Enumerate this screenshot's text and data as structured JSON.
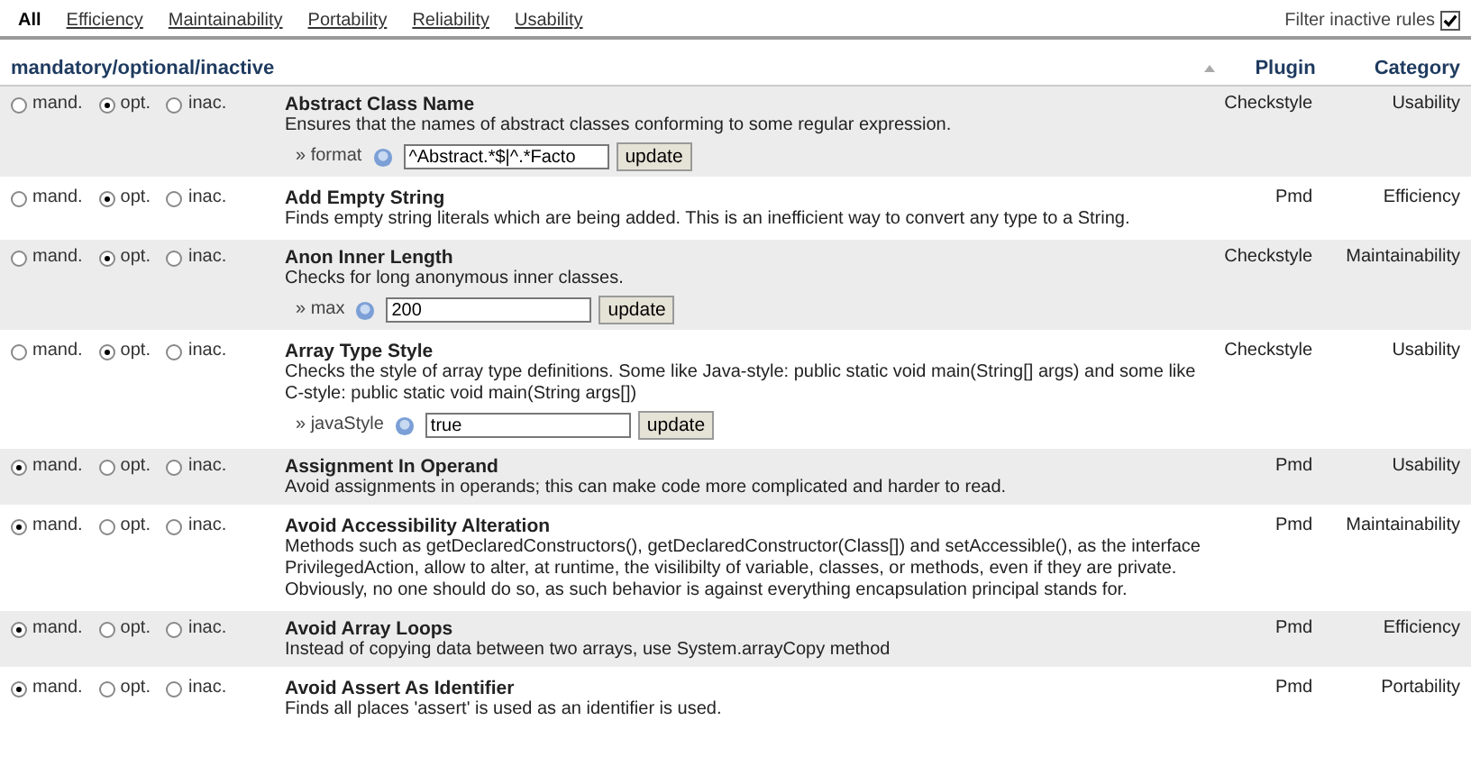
{
  "tabs": [
    {
      "label": "All",
      "selected": true
    },
    {
      "label": "Efficiency",
      "selected": false
    },
    {
      "label": "Maintainability",
      "selected": false
    },
    {
      "label": "Portability",
      "selected": false
    },
    {
      "label": "Reliability",
      "selected": false
    },
    {
      "label": "Usability",
      "selected": false
    }
  ],
  "filter": {
    "label": "Filter inactive rules",
    "checked": true
  },
  "table": {
    "columns": [
      "mandatory/optional/inactive",
      "Plugin",
      "Category"
    ],
    "rows": [
      {
        "options": [
          {
            "label": "mand.",
            "selected": false
          },
          {
            "label": "opt.",
            "selected": true
          },
          {
            "label": "inac.",
            "selected": false
          }
        ],
        "name": "Abstract Class Name",
        "description": "Ensures that the names of abstract classes conforming to some regular expression.",
        "param": {
          "name": "» format",
          "value": "^Abstract.*$|^.*Facto",
          "button": "update"
        },
        "plugin": "Checkstyle",
        "category": "Usability"
      },
      {
        "options": [
          {
            "label": "mand.",
            "selected": false
          },
          {
            "label": "opt.",
            "selected": true
          },
          {
            "label": "inac.",
            "selected": false
          }
        ],
        "name": "Add Empty String",
        "description": "Finds empty string literals which are being added. This is an inefficient way to convert any type to a String.",
        "plugin": "Pmd",
        "category": "Efficiency"
      },
      {
        "options": [
          {
            "label": "mand.",
            "selected": false
          },
          {
            "label": "opt.",
            "selected": true
          },
          {
            "label": "inac.",
            "selected": false
          }
        ],
        "name": "Anon Inner Length",
        "description": "Checks for long anonymous inner classes.",
        "param": {
          "name": "» max",
          "value": "200",
          "button": "update"
        },
        "plugin": "Checkstyle",
        "category": "Maintainability"
      },
      {
        "options": [
          {
            "label": "mand.",
            "selected": false
          },
          {
            "label": "opt.",
            "selected": true
          },
          {
            "label": "inac.",
            "selected": false
          }
        ],
        "name": "Array Type Style",
        "description": "Checks the style of array type definitions. Some like Java-style: public static void main(String[] args) and some like C-style: public static void main(String args[])",
        "param": {
          "name": "» javaStyle",
          "value": "true",
          "button": "update"
        },
        "plugin": "Checkstyle",
        "category": "Usability"
      },
      {
        "options": [
          {
            "label": "mand.",
            "selected": true
          },
          {
            "label": "opt.",
            "selected": false
          },
          {
            "label": "inac.",
            "selected": false
          }
        ],
        "name": "Assignment In Operand",
        "description": "Avoid assignments in operands; this can make code more complicated and harder to read.",
        "plugin": "Pmd",
        "category": "Usability"
      },
      {
        "options": [
          {
            "label": "mand.",
            "selected": true
          },
          {
            "label": "opt.",
            "selected": false
          },
          {
            "label": "inac.",
            "selected": false
          }
        ],
        "name": "Avoid Accessibility Alteration",
        "description": "Methods such as getDeclaredConstructors(), getDeclaredConstructor(Class[]) and setAccessible(), as the interface PrivilegedAction, allow to alter, at runtime, the visilibilty of variable, classes, or methods, even if they are private. Obviously, no one should do so, as such behavior is against everything encapsulation principal stands for.",
        "plugin": "Pmd",
        "category": "Maintainability"
      },
      {
        "options": [
          {
            "label": "mand.",
            "selected": true
          },
          {
            "label": "opt.",
            "selected": false
          },
          {
            "label": "inac.",
            "selected": false
          }
        ],
        "name": "Avoid Array Loops",
        "description": "Instead of copying data between two arrays, use System.arrayCopy method",
        "plugin": "Pmd",
        "category": "Efficiency"
      },
      {
        "options": [
          {
            "label": "mand.",
            "selected": true
          },
          {
            "label": "opt.",
            "selected": false
          },
          {
            "label": "inac.",
            "selected": false
          }
        ],
        "name": "Avoid Assert As Identifier",
        "description": "Finds all places 'assert' is used as an identifier is used.",
        "plugin": "Pmd",
        "category": "Portability"
      }
    ]
  }
}
